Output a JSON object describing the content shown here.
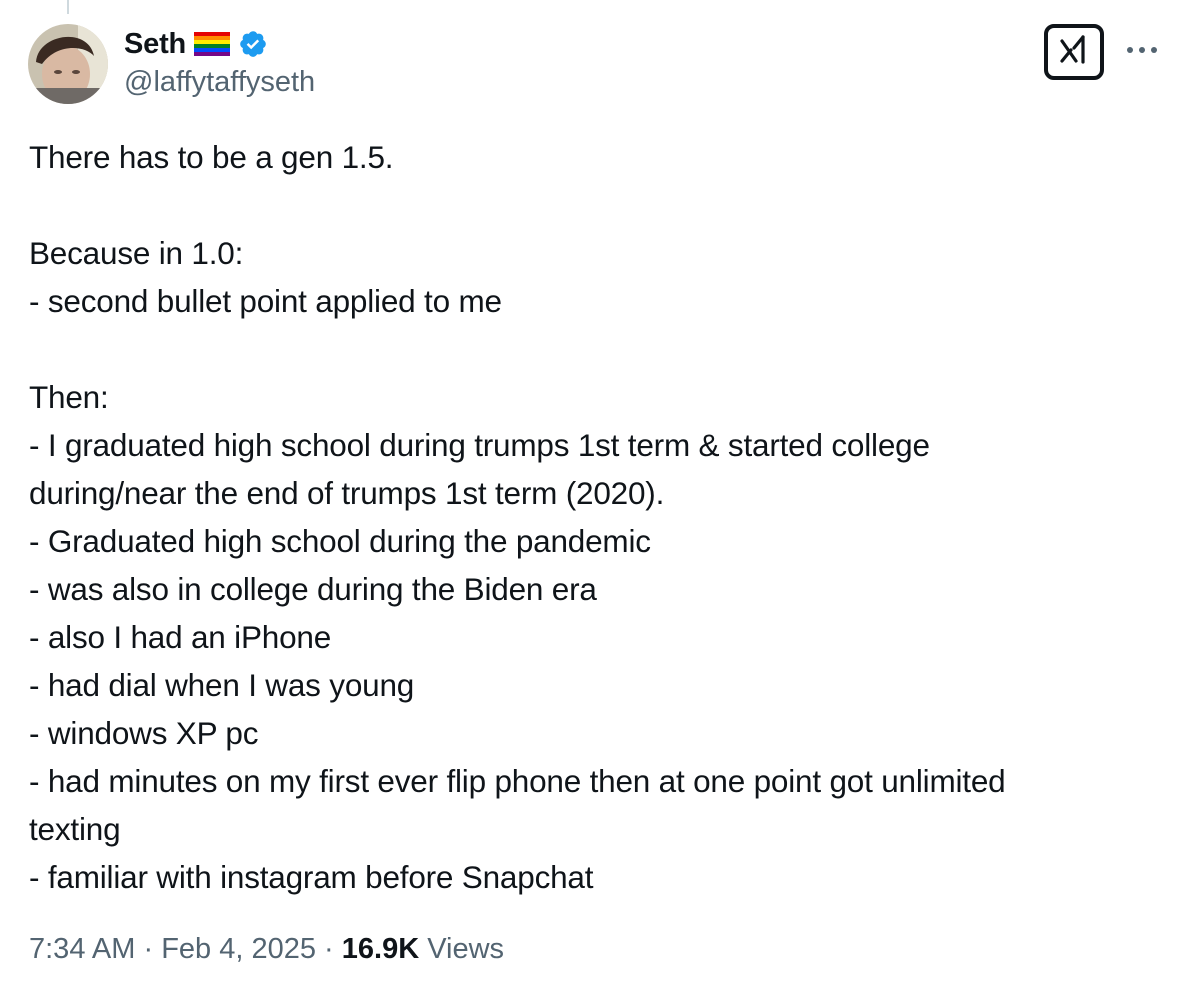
{
  "author": {
    "display_name": "Seth",
    "handle": "@laffytaffyseth",
    "flag_icon": "rainbow-flag-icon",
    "verified_icon": "verified-badge-icon",
    "verified_color": "#1d9bf0"
  },
  "actions": {
    "grok_icon": "grok-icon",
    "more_icon": "more-horizontal-icon"
  },
  "tweet": {
    "lines": [
      "There has to be a gen 1.5.",
      "",
      "Because in 1.0:",
      "- second bullet point applied to me",
      "",
      "Then:",
      "- I graduated high school during trumps 1st term & started college",
      "during/near the end of trumps 1st term (2020).",
      "- Graduated high school during the pandemic",
      "- was also in college during the Biden era",
      "- also I had an iPhone",
      "- had dial when I was young",
      "- windows XP pc",
      "- had minutes on my first ever flip phone then at one point got unlimited",
      "texting",
      "- familiar with instagram before Snapchat"
    ]
  },
  "meta": {
    "time": "7:34 AM",
    "separator": " · ",
    "date": "Feb 4, 2025",
    "views_count": "16.9K",
    "views_label": "Views"
  }
}
